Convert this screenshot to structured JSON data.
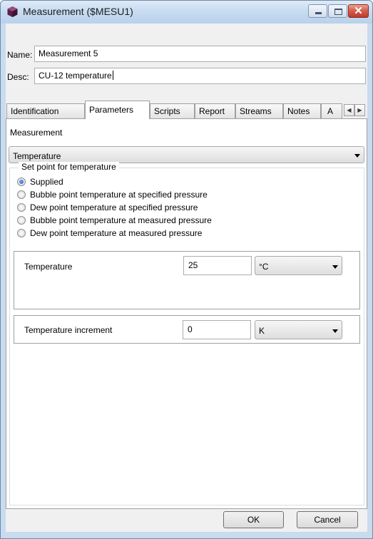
{
  "window": {
    "title": "Measurement ($MESU1)"
  },
  "fields": {
    "name_label": "Name:",
    "name_value": "Measurement 5",
    "desc_label": "Desc:",
    "desc_value": "CU-12 temperature"
  },
  "tabs": [
    {
      "label": "Identification",
      "active": false
    },
    {
      "label": "Parameters",
      "active": true
    },
    {
      "label": "Scripts",
      "active": false
    },
    {
      "label": "Report",
      "active": false
    },
    {
      "label": "Streams",
      "active": false
    },
    {
      "label": "Notes",
      "active": false
    },
    {
      "label": "A",
      "active": false
    }
  ],
  "parameters": {
    "measurement_label": "Measurement",
    "measurement_value": "Temperature",
    "setpoint_group": "Set point for temperature",
    "options": [
      {
        "label": "Supplied",
        "checked": true
      },
      {
        "label": "Bubble point temperature at specified pressure",
        "checked": false
      },
      {
        "label": "Dew point temperature at specified pressure",
        "checked": false
      },
      {
        "label": "Bubble point temperature at measured pressure",
        "checked": false
      },
      {
        "label": "Dew point temperature at measured pressure",
        "checked": false
      }
    ],
    "temperature": {
      "label": "Temperature",
      "value": "25",
      "unit": "°C"
    },
    "increment": {
      "label": "Temperature increment",
      "value": "0",
      "unit": "K"
    }
  },
  "buttons": {
    "ok": "OK",
    "cancel": "Cancel"
  },
  "colors": {
    "title_bar": "#c8dcf1",
    "close": "#c0392b",
    "radio_selected": "#1f5fbf"
  }
}
